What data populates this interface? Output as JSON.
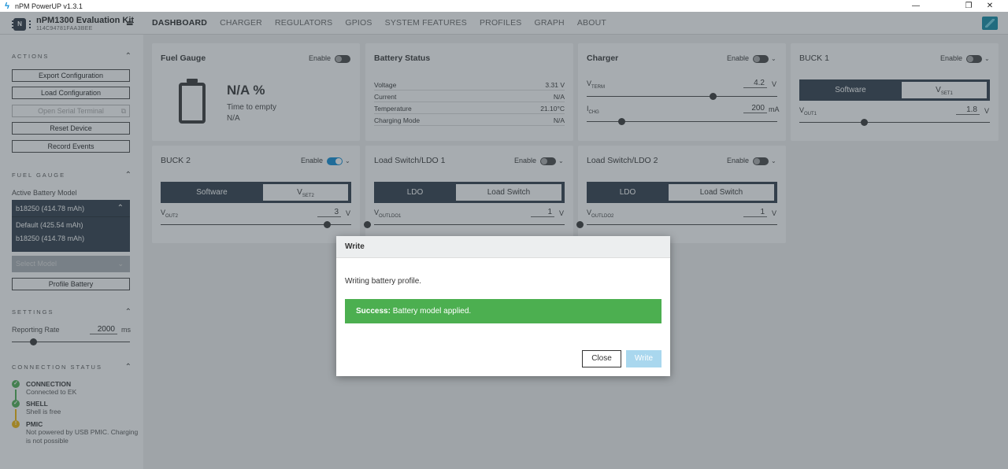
{
  "window": {
    "title": "nPM PowerUP v1.3.1"
  },
  "header": {
    "device_name": "nPM1300 Evaluation Kit",
    "device_serial": "114C94781FAA3BEE",
    "chip_label": "N",
    "nav": [
      "DASHBOARD",
      "CHARGER",
      "REGULATORS",
      "GPIOS",
      "SYSTEM FEATURES",
      "PROFILES",
      "GRAPH",
      "ABOUT"
    ],
    "active_nav": "DASHBOARD"
  },
  "sidebar": {
    "actions": {
      "title": "ACTIONS",
      "buttons": [
        "Export Configuration",
        "Load Configuration",
        "Open Serial Terminal",
        "Reset Device",
        "Record Events"
      ]
    },
    "fuel_gauge": {
      "title": "FUEL GAUGE",
      "active_model_label": "Active Battery Model",
      "selected_model": "b18250 (414.78 mAh)",
      "options": [
        "Default (425.54 mAh)",
        "b18250 (414.78 mAh)"
      ],
      "select_model_placeholder": "Select Model",
      "profile_button": "Profile Battery"
    },
    "settings": {
      "title": "SETTINGS",
      "reporting_rate_label": "Reporting Rate",
      "reporting_rate_value": "2000",
      "reporting_rate_unit": "ms",
      "reporting_rate_slider_fraction": 0.18
    },
    "connection_status": {
      "title": "CONNECTION STATUS",
      "items": [
        {
          "name": "CONNECTION",
          "desc": "Connected to EK",
          "state": "ok"
        },
        {
          "name": "SHELL",
          "desc": "Shell is free",
          "state": "ok"
        },
        {
          "name": "PMIC",
          "desc": "Not powered by USB PMIC. Charging is not possible",
          "state": "warn"
        }
      ]
    }
  },
  "cards": {
    "fuel_gauge": {
      "title": "Fuel Gauge",
      "enable_label": "Enable",
      "enabled": false,
      "percent": "N/A %",
      "time_label": "Time to empty",
      "time_value": "N/A"
    },
    "battery_status": {
      "title": "Battery Status",
      "rows": [
        {
          "key": "Voltage",
          "value": "3.31 V"
        },
        {
          "key": "Current",
          "value": "N/A"
        },
        {
          "key": "Temperature",
          "value": "21.10°C"
        },
        {
          "key": "Charging Mode",
          "value": "N/A"
        }
      ]
    },
    "charger": {
      "title": "Charger",
      "enable_label": "Enable",
      "enabled": false,
      "vterm_label": "V",
      "vterm_sub": "TERM",
      "vterm_value": "4.2",
      "vterm_unit": "V",
      "vterm_fraction": 0.66,
      "ichg_label": "I",
      "ichg_sub": "CHG",
      "ichg_value": "200",
      "ichg_unit": "mA",
      "ichg_fraction": 0.18
    },
    "buck1": {
      "title": "BUCK 1",
      "enable_label": "Enable",
      "enabled": false,
      "mode_left": "Software",
      "mode_right_label": "V",
      "mode_right_sub": "SET1",
      "vout_label": "V",
      "vout_sub": "OUT1",
      "vout_value": "1.8",
      "vout_unit": "V",
      "vout_fraction": 0.34
    },
    "buck2": {
      "title": "BUCK 2",
      "enable_label": "Enable",
      "enabled": true,
      "mode_left": "Software",
      "mode_right_label": "V",
      "mode_right_sub": "SET2",
      "vout_label": "V",
      "vout_sub": "OUT2",
      "vout_value": "3",
      "vout_unit": "V",
      "vout_fraction": 0.87
    },
    "ldo1": {
      "title": "Load Switch/LDO 1",
      "enable_label": "Enable",
      "enabled": false,
      "mode_left": "LDO",
      "mode_right": "Load Switch",
      "vout_label": "V",
      "vout_sub": "OUTLDO1",
      "vout_value": "1",
      "vout_unit": "V",
      "vout_fraction": 0.0
    },
    "ldo2": {
      "title": "Load Switch/LDO 2",
      "enable_label": "Enable",
      "enabled": false,
      "mode_left": "LDO",
      "mode_right": "Load Switch",
      "vout_label": "V",
      "vout_sub": "OUTLDO2",
      "vout_value": "1",
      "vout_unit": "V",
      "vout_fraction": 0.0
    }
  },
  "dialog": {
    "title": "Write",
    "message": "Writing battery profile.",
    "alert_strong": "Success:",
    "alert_text": "Battery model applied.",
    "close_label": "Close",
    "write_label": "Write"
  },
  "colors": {
    "accent": "#0a8bd6",
    "dark": "#2d3a47",
    "success": "#4caf50",
    "warn": "#f2b705"
  }
}
